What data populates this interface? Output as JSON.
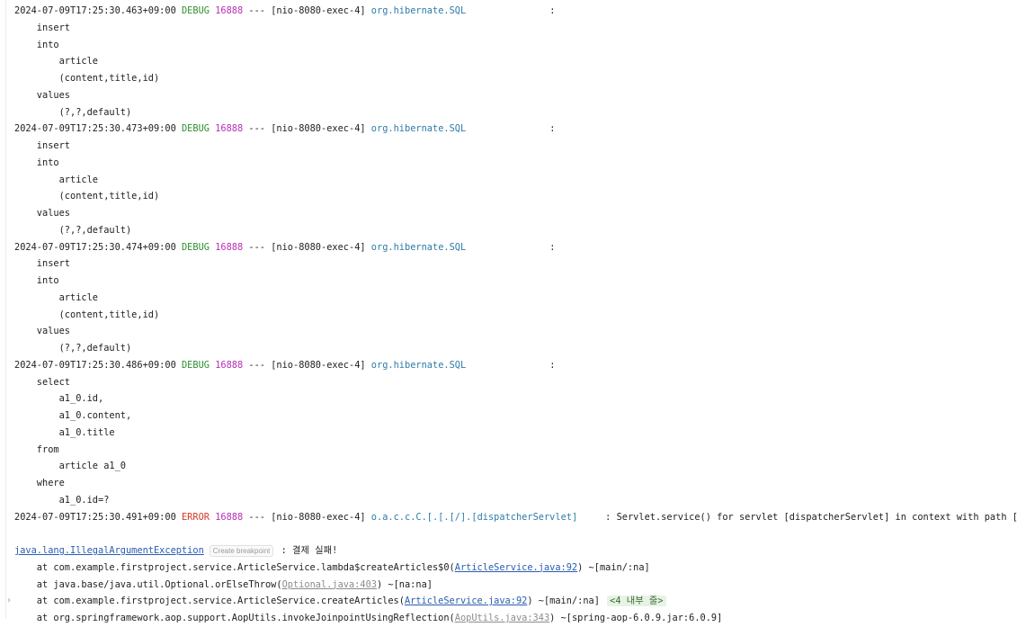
{
  "log": {
    "entries": [
      {
        "timestamp": "2024-07-09T17:25:30.463+09:00",
        "level": "DEBUG",
        "pid": "16888",
        "sep": "---",
        "thread": "[nio-8080-exec-4]",
        "logger": "org.hibernate.SQL",
        "colon": ":",
        "body": [
          "    insert",
          "    into",
          "        article",
          "        (content,title,id)",
          "    values",
          "        (?,?,default)"
        ]
      },
      {
        "timestamp": "2024-07-09T17:25:30.473+09:00",
        "level": "DEBUG",
        "pid": "16888",
        "sep": "---",
        "thread": "[nio-8080-exec-4]",
        "logger": "org.hibernate.SQL",
        "colon": ":",
        "body": [
          "    insert",
          "    into",
          "        article",
          "        (content,title,id)",
          "    values",
          "        (?,?,default)"
        ]
      },
      {
        "timestamp": "2024-07-09T17:25:30.474+09:00",
        "level": "DEBUG",
        "pid": "16888",
        "sep": "---",
        "thread": "[nio-8080-exec-4]",
        "logger": "org.hibernate.SQL",
        "colon": ":",
        "body": [
          "    insert",
          "    into",
          "        article",
          "        (content,title,id)",
          "    values",
          "        (?,?,default)"
        ]
      },
      {
        "timestamp": "2024-07-09T17:25:30.486+09:00",
        "level": "DEBUG",
        "pid": "16888",
        "sep": "---",
        "thread": "[nio-8080-exec-4]",
        "logger": "org.hibernate.SQL",
        "colon": ":",
        "body": [
          "    select",
          "        a1_0.id,",
          "        a1_0.content,",
          "        a1_0.title",
          "    from",
          "        article a1_0",
          "    where",
          "        a1_0.id=?"
        ]
      }
    ],
    "error": {
      "timestamp": "2024-07-09T17:25:30.491+09:00",
      "level": "ERROR",
      "pid": "16888",
      "sep": "---",
      "thread": "[nio-8080-exec-4]",
      "logger": "o.a.c.c.C.[.[.[/].[dispatcherServlet]",
      "message": ": Servlet.service() for servlet [dispatcherServlet] in context with path [] threw"
    },
    "exception": {
      "class": "java.lang.IllegalArgumentException",
      "breakpoint_hint": "Create breakpoint",
      "message": ": 결제 실패!"
    },
    "stack": [
      {
        "prefix": "    at com.example.firstproject.service.ArticleService.lambda$createArticles$0(",
        "link": "ArticleService.java:92",
        "suffix": ") ~[main/:na]",
        "muted": false,
        "fold": ""
      },
      {
        "prefix": "    at java.base/java.util.Optional.orElseThrow(",
        "link": "Optional.java:403",
        "suffix": ") ~[na:na]",
        "muted": true,
        "fold": ""
      },
      {
        "prefix": "    at com.example.firstproject.service.ArticleService.createArticles(",
        "link": "ArticleService.java:92",
        "suffix": ") ~[main/:na]",
        "muted": false,
        "fold": "<4 내부 줄>"
      },
      {
        "prefix": "    at org.springframework.aop.support.AopUtils.invokeJoinpointUsingReflection(",
        "link": "AopUtils.java:343",
        "suffix": ") ~[spring-aop-6.0.9.jar:6.0.9]",
        "muted": true,
        "fold": ""
      }
    ]
  },
  "colors": {
    "debug": "#2f8f2f",
    "error": "#d4382b",
    "pid": "#b52fb5",
    "logger": "#2e7ca8",
    "link": "#2a5db0"
  },
  "icons": {
    "fold_arrow": "chevron-right-icon"
  }
}
